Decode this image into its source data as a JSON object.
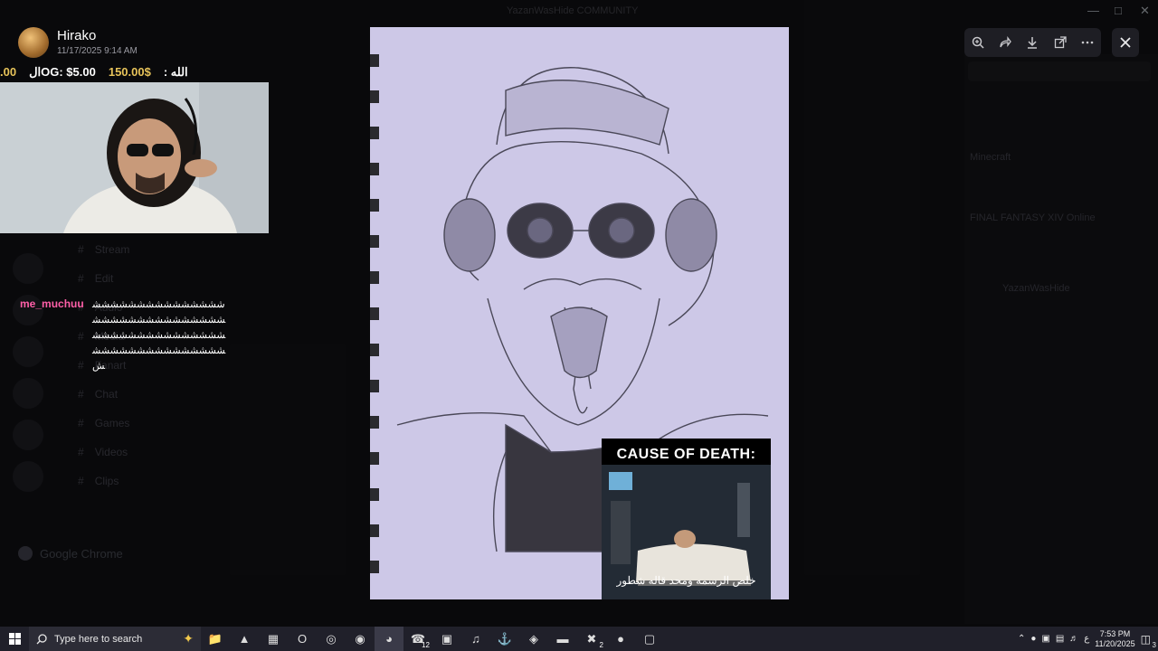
{
  "window_title": "YazanWasHide COMMUNITY",
  "background_channels": [
    "Stream",
    "Edit",
    "Audio",
    "Media",
    "Fanart",
    "Chat",
    "Games",
    "Videos",
    "Clips"
  ],
  "background_members": [
    "Minecraft",
    "FINAL FANTASY XIV Online",
    "YazanWasHide"
  ],
  "background_app": "Google Chrome",
  "overlay": {
    "author_name": "Hirako",
    "timestamp": "11/17/2025 9:14 AM",
    "ticker": [
      {
        "text": ".00",
        "color": "gold"
      },
      {
        "text": "الOG: $5.00",
        "color": "white"
      },
      {
        "text": "150.00$",
        "color": "gold"
      },
      {
        "text": ": الله",
        "color": "white"
      }
    ],
    "chat": {
      "username": "me_muchuu",
      "message": "ششششششششششششششششششششششششششششششششششششششششششششششششششششششششششششش"
    }
  },
  "viewer": {
    "toolbar": [
      "zoom-in-icon",
      "forward-icon",
      "download-icon",
      "open-external-icon",
      "more-icon"
    ],
    "close_icon": "close-icon",
    "meme": {
      "title": "CAUSE OF DEATH:",
      "caption": "خلص الرسمه ومحد قاله شطور"
    }
  },
  "taskbar": {
    "search_placeholder": "Type here to search",
    "apps": [
      {
        "name": "file-explorer-icon",
        "glyph": "📁",
        "badge": ""
      },
      {
        "name": "brave-icon",
        "glyph": "▲",
        "badge": ""
      },
      {
        "name": "store-icon",
        "glyph": "▦",
        "badge": ""
      },
      {
        "name": "outlook-icon",
        "glyph": "O",
        "badge": ""
      },
      {
        "name": "obs-icon",
        "glyph": "◎",
        "badge": ""
      },
      {
        "name": "steam-icon",
        "glyph": "◉",
        "badge": ""
      },
      {
        "name": "discord-icon",
        "glyph": "◕",
        "badge": ""
      },
      {
        "name": "whatsapp-icon",
        "glyph": "☎",
        "badge": "12"
      },
      {
        "name": "app-green-icon",
        "glyph": "▣",
        "badge": ""
      },
      {
        "name": "spotify-icon",
        "glyph": "♫",
        "badge": ""
      },
      {
        "name": "controller-icon",
        "glyph": "⚓",
        "badge": ""
      },
      {
        "name": "vpn-icon",
        "glyph": "◈",
        "badge": ""
      },
      {
        "name": "terminal-icon",
        "glyph": "▬",
        "badge": ""
      },
      {
        "name": "xbox-icon",
        "glyph": "✖",
        "badge": "2"
      },
      {
        "name": "chrome-icon",
        "glyph": "●",
        "badge": ""
      },
      {
        "name": "window-icon",
        "glyph": "▢",
        "badge": ""
      }
    ],
    "tray": {
      "lang": "ع",
      "time": "7:53 PM",
      "date": "11/20/2025",
      "notifications": "3"
    }
  },
  "colors": {
    "accent_gold": "#e7c35a",
    "chat_username": "#ff5fa8",
    "paper": "#ccc7e6"
  }
}
